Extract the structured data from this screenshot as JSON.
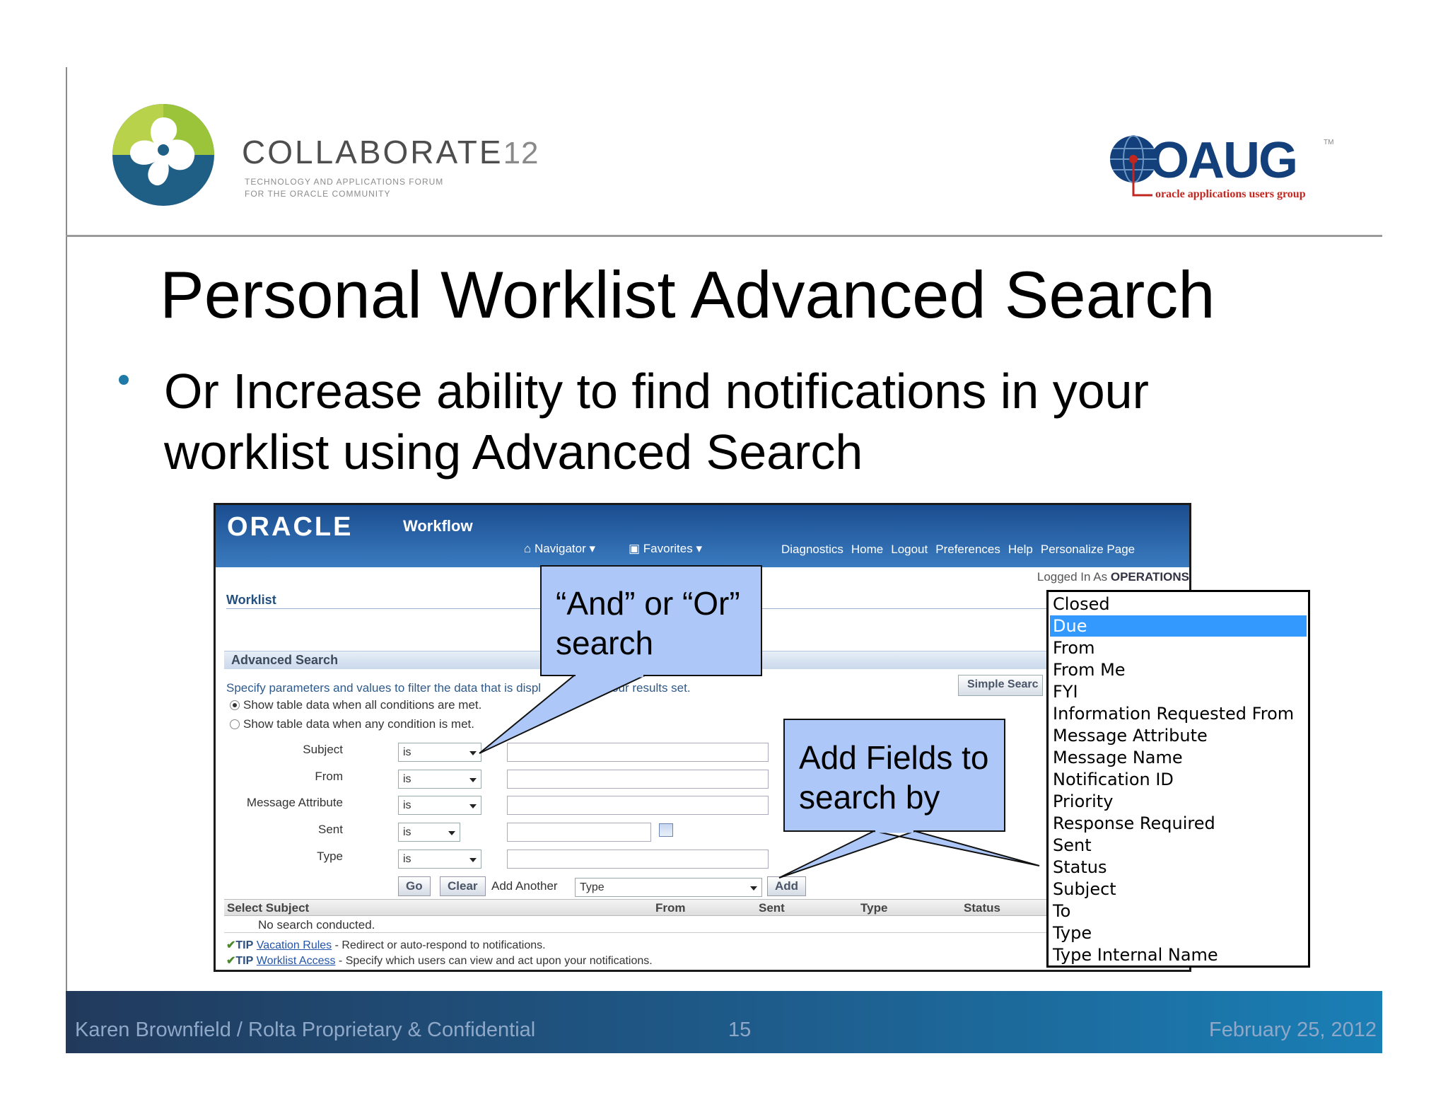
{
  "header": {
    "collaborate": "COLLABORATE",
    "collaborate_num": "12",
    "tagline_1": "TECHNOLOGY AND APPLICATIONS FORUM",
    "tagline_2": "FOR THE ORACLE COMMUNITY",
    "oaug": "OAUG",
    "oaug_tm": "TM",
    "oaug_sub": "oracle applications users group"
  },
  "title": "Personal Worklist Advanced Search",
  "bullet": "Or Increase ability to find notifications in your worklist using Advanced Search",
  "oracle": {
    "logo": "ORACLE",
    "product": "Workflow",
    "navigator": "Navigator",
    "favorites": "Favorites",
    "links": [
      "Diagnostics",
      "Home",
      "Logout",
      "Preferences",
      "Help",
      "Personalize Page"
    ],
    "logged_in_prefix": "Logged In As",
    "logged_in_user": "OPERATIONS",
    "breadcrumb": "Worklist",
    "section_title": "Advanced Search",
    "instructions": "Specify parameters and values to filter the data that is displ",
    "instructions_tail": "our results set.",
    "simple_search": "Simple Searc",
    "radio_all": "Show table data when all conditions are met.",
    "radio_any": "Show table data when any condition is met.",
    "fields": [
      {
        "label": "Subject",
        "op": "is"
      },
      {
        "label": "From",
        "op": "is"
      },
      {
        "label": "Message Attribute",
        "op": "is"
      },
      {
        "label": "Sent",
        "op": "is"
      },
      {
        "label": "Type",
        "op": "is"
      }
    ],
    "go": "Go",
    "clear": "Clear",
    "add_another": "Add Another",
    "add_another_value": "Type",
    "add": "Add",
    "columns": [
      "Select Subject",
      "From",
      "Sent",
      "Type",
      "Status"
    ],
    "no_search": "No search conducted.",
    "tips": [
      {
        "tip": "TIP",
        "link": "Vacation Rules",
        "text": " - Redirect or auto-respond to notifications."
      },
      {
        "tip": "TIP",
        "link": "Worklist Access",
        "text": " - Specify which users can view and act upon your notifications."
      }
    ]
  },
  "dropdown": {
    "selected": "Due",
    "items": [
      "Closed",
      "Due",
      "From",
      "From Me",
      "FYI",
      "Information Requested From",
      "Message Attribute",
      "Message Name",
      "Notification ID",
      "Priority",
      "Response Required",
      "Sent",
      "Status",
      "Subject",
      "To",
      "Type",
      "Type Internal Name"
    ]
  },
  "callouts": {
    "and_or_1": "“And” or “Or”",
    "and_or_2": "search",
    "add_fields_1": "Add Fields to",
    "add_fields_2": "search by"
  },
  "footer": {
    "left": "Karen Brownfield  /  Rolta  Proprietary & Confidential",
    "page": "15",
    "date": "February 25, 2012"
  },
  "colors": {
    "callout": "#adc8f8",
    "oracle_header": "#2b6bb0",
    "dropdown_selected": "#3399ff",
    "footer": "#1e5d8d"
  }
}
